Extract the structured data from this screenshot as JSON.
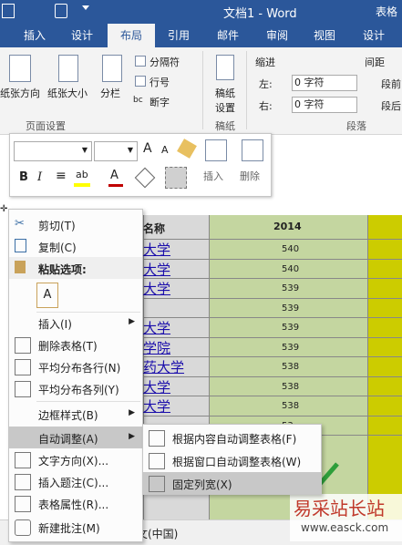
{
  "title_bar": {
    "title": "文档1 - Word",
    "right_text": "表格"
  },
  "tabs": [
    "插入",
    "设计",
    "布局",
    "引用",
    "邮件",
    "审阅",
    "视图",
    "设计"
  ],
  "active_tab_index": 2,
  "ribbon": {
    "page_setup": {
      "paper_direction": "纸张方向",
      "paper_size": "纸张大小",
      "columns": "分栏",
      "breaks": "分隔符",
      "line_numbers": "行号",
      "hyphenation": "断字",
      "group_label": "页面设置"
    },
    "manuscript": {
      "label_line1": "稿纸",
      "label_line2": "设置",
      "group_label": "稿纸"
    },
    "indent": {
      "title": "缩进",
      "left_label": "左:",
      "left_value": "0 字符",
      "right_label": "右:",
      "right_value": "0 字符"
    },
    "spacing": {
      "title": "间距",
      "before_label": "段前",
      "after_label": "段后"
    },
    "paragraph_group_label": "段落"
  },
  "mini_toolbar": {
    "bold": "B",
    "italic": "I",
    "insert_label": "插入",
    "delete_label": "删除"
  },
  "table": {
    "header_col2": "名称",
    "header_col3": "2014",
    "rows": [
      {
        "name": "大学",
        "value": "540"
      },
      {
        "name": "大学",
        "value": "540"
      },
      {
        "name": "大学",
        "value": "539"
      },
      {
        "name": "",
        "value": "539"
      },
      {
        "name": "大学",
        "value": "539"
      },
      {
        "name": "学院",
        "value": "539"
      },
      {
        "name": "药大学",
        "value": "538"
      },
      {
        "name": "大学",
        "value": "538"
      },
      {
        "name": "大学",
        "value": "538"
      },
      {
        "name": "",
        "value": "53"
      },
      {
        "name": "院",
        "value": "53"
      }
    ]
  },
  "status_bar": {
    "language": "文(中国)"
  },
  "context_menu": {
    "cut": "剪切(T)",
    "copy": "复制(C)",
    "paste_options": "粘贴选项:",
    "insert": "插入(I)",
    "delete_table": "删除表格(T)",
    "distribute_rows": "平均分布各行(N)",
    "distribute_cols": "平均分布各列(Y)",
    "border_styles": "边框样式(B)",
    "autofit": "自动调整(A)",
    "text_direction": "文字方向(X)...",
    "insert_caption": "插入题注(C)...",
    "table_properties": "表格属性(R)...",
    "new_comment": "新建批注(M)"
  },
  "submenu": {
    "fit_contents": "根据内容自动调整表格(F)",
    "fit_window": "根据窗口自动调整表格(W)",
    "fixed_width": "固定列宽(X)"
  },
  "watermark": {
    "text": "易采站长站",
    "url": "www.easck.com"
  },
  "colors": {
    "word_blue": "#2b579a",
    "table_green": "#c4d6a0",
    "table_yellow": "#cccc00",
    "menu_highlight": "#c8c8c8"
  }
}
